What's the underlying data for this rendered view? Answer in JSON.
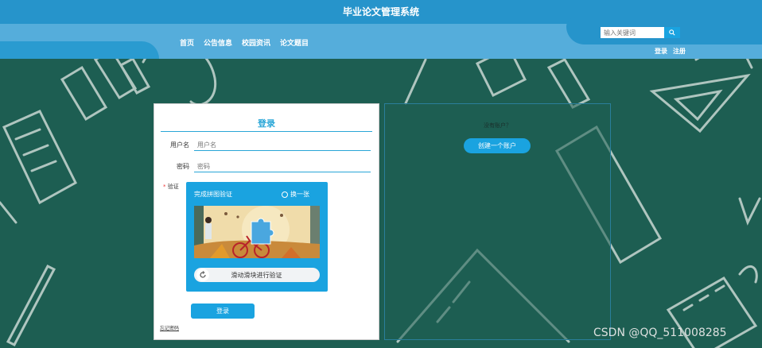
{
  "header": {
    "title": "毕业论文管理系统",
    "nav": [
      "首页",
      "公告信息",
      "校园资讯",
      "论文题目"
    ],
    "search_placeholder": "输入关键词",
    "search_icon": "search-icon",
    "auth": {
      "login": "登录",
      "register": "注册"
    }
  },
  "login": {
    "title": "登录",
    "username_label": "用户名",
    "username_placeholder": "用户名",
    "password_label": "密码",
    "password_placeholder": "密码",
    "captcha_label": "验证",
    "captcha": {
      "title": "完成拼图验证",
      "refresh": "换一张",
      "slider_text": "滑动滑块进行验证"
    },
    "submit": "登录",
    "forgot": "忘记密码"
  },
  "register": {
    "question": "没有账户？",
    "button": "创建一个账户"
  },
  "watermark": "CSDN @QQ_511008285",
  "colors": {
    "accent": "#1aa3e0",
    "header": "#2a9bd0",
    "background": "#1d5e52"
  }
}
